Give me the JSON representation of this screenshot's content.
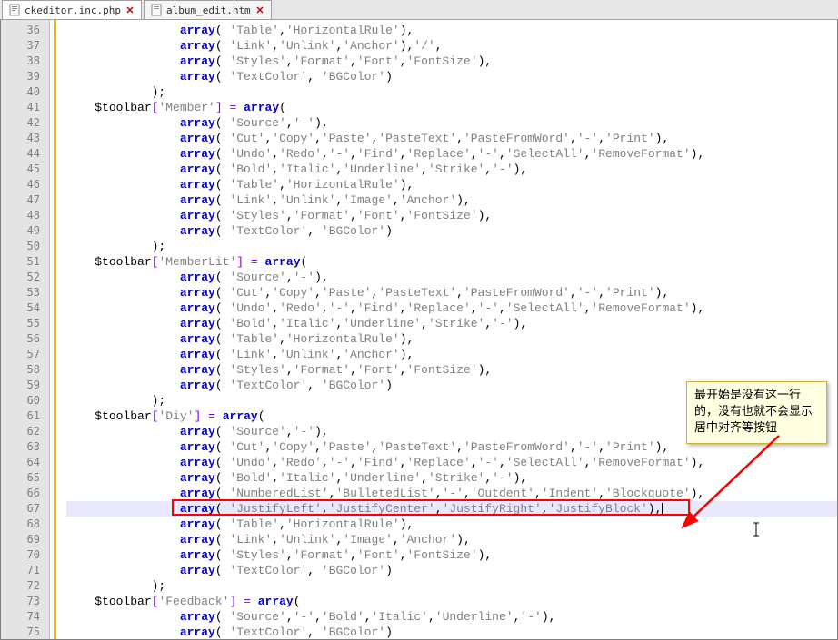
{
  "tabs": [
    {
      "name": "ckeditor.inc.php",
      "active": true
    },
    {
      "name": "album_edit.htm",
      "active": false
    }
  ],
  "lines": [
    {
      "n": 36,
      "i": 4,
      "t": "array",
      "args": "( 'Table','HorizontalRule'),"
    },
    {
      "n": 37,
      "i": 4,
      "t": "array",
      "args": "( 'Link','Unlink','Anchor'),'/',"
    },
    {
      "n": 38,
      "i": 4,
      "t": "array",
      "args": "( 'Styles','Format','Font','FontSize'),"
    },
    {
      "n": 39,
      "i": 4,
      "t": "array",
      "args": "( 'TextColor', 'BGColor')"
    },
    {
      "n": 40,
      "i": 3,
      "t": "",
      "args": ");"
    },
    {
      "n": 41,
      "i": 1,
      "t": "var",
      "varname": "$toolbar",
      "key": "'Member'",
      "args": " = ",
      "kw": "array",
      "tail": "("
    },
    {
      "n": 42,
      "i": 4,
      "t": "array",
      "args": "( 'Source','-'),"
    },
    {
      "n": 43,
      "i": 4,
      "t": "array",
      "args": "( 'Cut','Copy','Paste','PasteText','PasteFromWord','-','Print'),"
    },
    {
      "n": 44,
      "i": 4,
      "t": "array",
      "args": "( 'Undo','Redo','-','Find','Replace','-','SelectAll','RemoveFormat'),"
    },
    {
      "n": 45,
      "i": 4,
      "t": "array",
      "args": "( 'Bold','Italic','Underline','Strike','-'),"
    },
    {
      "n": 46,
      "i": 4,
      "t": "array",
      "args": "( 'Table','HorizontalRule'),"
    },
    {
      "n": 47,
      "i": 4,
      "t": "array",
      "args": "( 'Link','Unlink','Image','Anchor'),"
    },
    {
      "n": 48,
      "i": 4,
      "t": "array",
      "args": "( 'Styles','Format','Font','FontSize'),"
    },
    {
      "n": 49,
      "i": 4,
      "t": "array",
      "args": "( 'TextColor', 'BGColor')"
    },
    {
      "n": 50,
      "i": 3,
      "t": "",
      "args": ");"
    },
    {
      "n": 51,
      "i": 1,
      "t": "var",
      "varname": "$toolbar",
      "key": "'MemberLit'",
      "args": " = ",
      "kw": "array",
      "tail": "("
    },
    {
      "n": 52,
      "i": 4,
      "t": "array",
      "args": "( 'Source','-'),"
    },
    {
      "n": 53,
      "i": 4,
      "t": "array",
      "args": "( 'Cut','Copy','Paste','PasteText','PasteFromWord','-','Print'),"
    },
    {
      "n": 54,
      "i": 4,
      "t": "array",
      "args": "( 'Undo','Redo','-','Find','Replace','-','SelectAll','RemoveFormat'),"
    },
    {
      "n": 55,
      "i": 4,
      "t": "array",
      "args": "( 'Bold','Italic','Underline','Strike','-'),"
    },
    {
      "n": 56,
      "i": 4,
      "t": "array",
      "args": "( 'Table','HorizontalRule'),"
    },
    {
      "n": 57,
      "i": 4,
      "t": "array",
      "args": "( 'Link','Unlink','Anchor'),"
    },
    {
      "n": 58,
      "i": 4,
      "t": "array",
      "args": "( 'Styles','Format','Font','FontSize'),"
    },
    {
      "n": 59,
      "i": 4,
      "t": "array",
      "args": "( 'TextColor', 'BGColor')"
    },
    {
      "n": 60,
      "i": 3,
      "t": "",
      "args": ");"
    },
    {
      "n": 61,
      "i": 1,
      "t": "var",
      "varname": "$toolbar",
      "key": "'Diy'",
      "args": " = ",
      "kw": "array",
      "tail": "("
    },
    {
      "n": 62,
      "i": 4,
      "t": "array",
      "args": "( 'Source','-'),"
    },
    {
      "n": 63,
      "i": 4,
      "t": "array",
      "args": "( 'Cut','Copy','Paste','PasteText','PasteFromWord','-','Print'),"
    },
    {
      "n": 64,
      "i": 4,
      "t": "array",
      "args": "( 'Undo','Redo','-','Find','Replace','-','SelectAll','RemoveFormat'),"
    },
    {
      "n": 65,
      "i": 4,
      "t": "array",
      "args": "( 'Bold','Italic','Underline','Strike','-'),"
    },
    {
      "n": 66,
      "i": 4,
      "t": "array",
      "args": "( 'NumberedList','BulletedList','-','Outdent','Indent','Blockquote'),"
    },
    {
      "n": 67,
      "i": 4,
      "t": "array",
      "args": "( 'JustifyLeft','JustifyCenter','JustifyRight','JustifyBlock'),",
      "hl": true
    },
    {
      "n": 68,
      "i": 4,
      "t": "array",
      "args": "( 'Table','HorizontalRule'),"
    },
    {
      "n": 69,
      "i": 4,
      "t": "array",
      "args": "( 'Link','Unlink','Image','Anchor'),"
    },
    {
      "n": 70,
      "i": 4,
      "t": "array",
      "args": "( 'Styles','Format','Font','FontSize'),"
    },
    {
      "n": 71,
      "i": 4,
      "t": "array",
      "args": "( 'TextColor', 'BGColor')"
    },
    {
      "n": 72,
      "i": 3,
      "t": "",
      "args": ");"
    },
    {
      "n": 73,
      "i": 1,
      "t": "var",
      "varname": "$toolbar",
      "key": "'Feedback'",
      "args": " = ",
      "kw": "array",
      "tail": "("
    },
    {
      "n": 74,
      "i": 4,
      "t": "array",
      "args": "( 'Source','-','Bold','Italic','Underline','-'),"
    },
    {
      "n": 75,
      "i": 4,
      "t": "array",
      "args": "( 'TextColor', 'BGColor')",
      "partial": true
    }
  ],
  "callout_text": "最开始是没有这一行的，没有也就不会显示居中对齐等按钮",
  "redbox": {
    "line": 67
  }
}
